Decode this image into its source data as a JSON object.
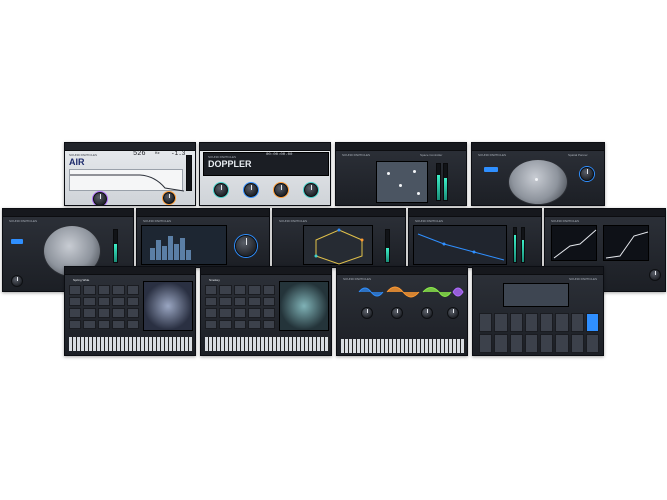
{
  "image_alt": "Collage of Sound Particles audio plugin interfaces",
  "panels": {
    "air": {
      "brand": "SOUND PARTICLES",
      "name": "AIR",
      "readout_main": "526",
      "readout_unit": "Hz",
      "readout_side": "-1.3"
    },
    "doppler": {
      "brand": "SOUND PARTICLES",
      "name": "DOPPLER",
      "readout": "00:00:00.00"
    },
    "space_controller": {
      "brand": "SOUND PARTICLES",
      "label": "Space Controller"
    },
    "sky_dome": {
      "brand": "SOUND PARTICLES",
      "label": "Spatial Panner"
    },
    "immersive_panner": {
      "brand": "SOUND PARTICLES"
    },
    "spectral": {
      "brand": "SOUND PARTICLES"
    },
    "energy_panner": {
      "brand": "SOUND PARTICLES"
    },
    "inner_room": {
      "brand": "SOUND PARTICLES"
    },
    "skydust": {
      "brand": "SOUND PARTICLES"
    },
    "sp_sampler_a": {
      "preset": "Spring Wide"
    },
    "sp_sampler_b": {
      "preset": "Smokey"
    },
    "waveform_panel": {
      "brand": "SOUND PARTICLES"
    },
    "drum_panel": {
      "brand": "SOUND PARTICLES"
    }
  },
  "colors": {
    "accent_blue": "#2f8fff",
    "accent_orange": "#ff9a32",
    "accent_teal": "#3fd0c9",
    "accent_purple": "#b06cff",
    "accent_green": "#8bea4a"
  }
}
